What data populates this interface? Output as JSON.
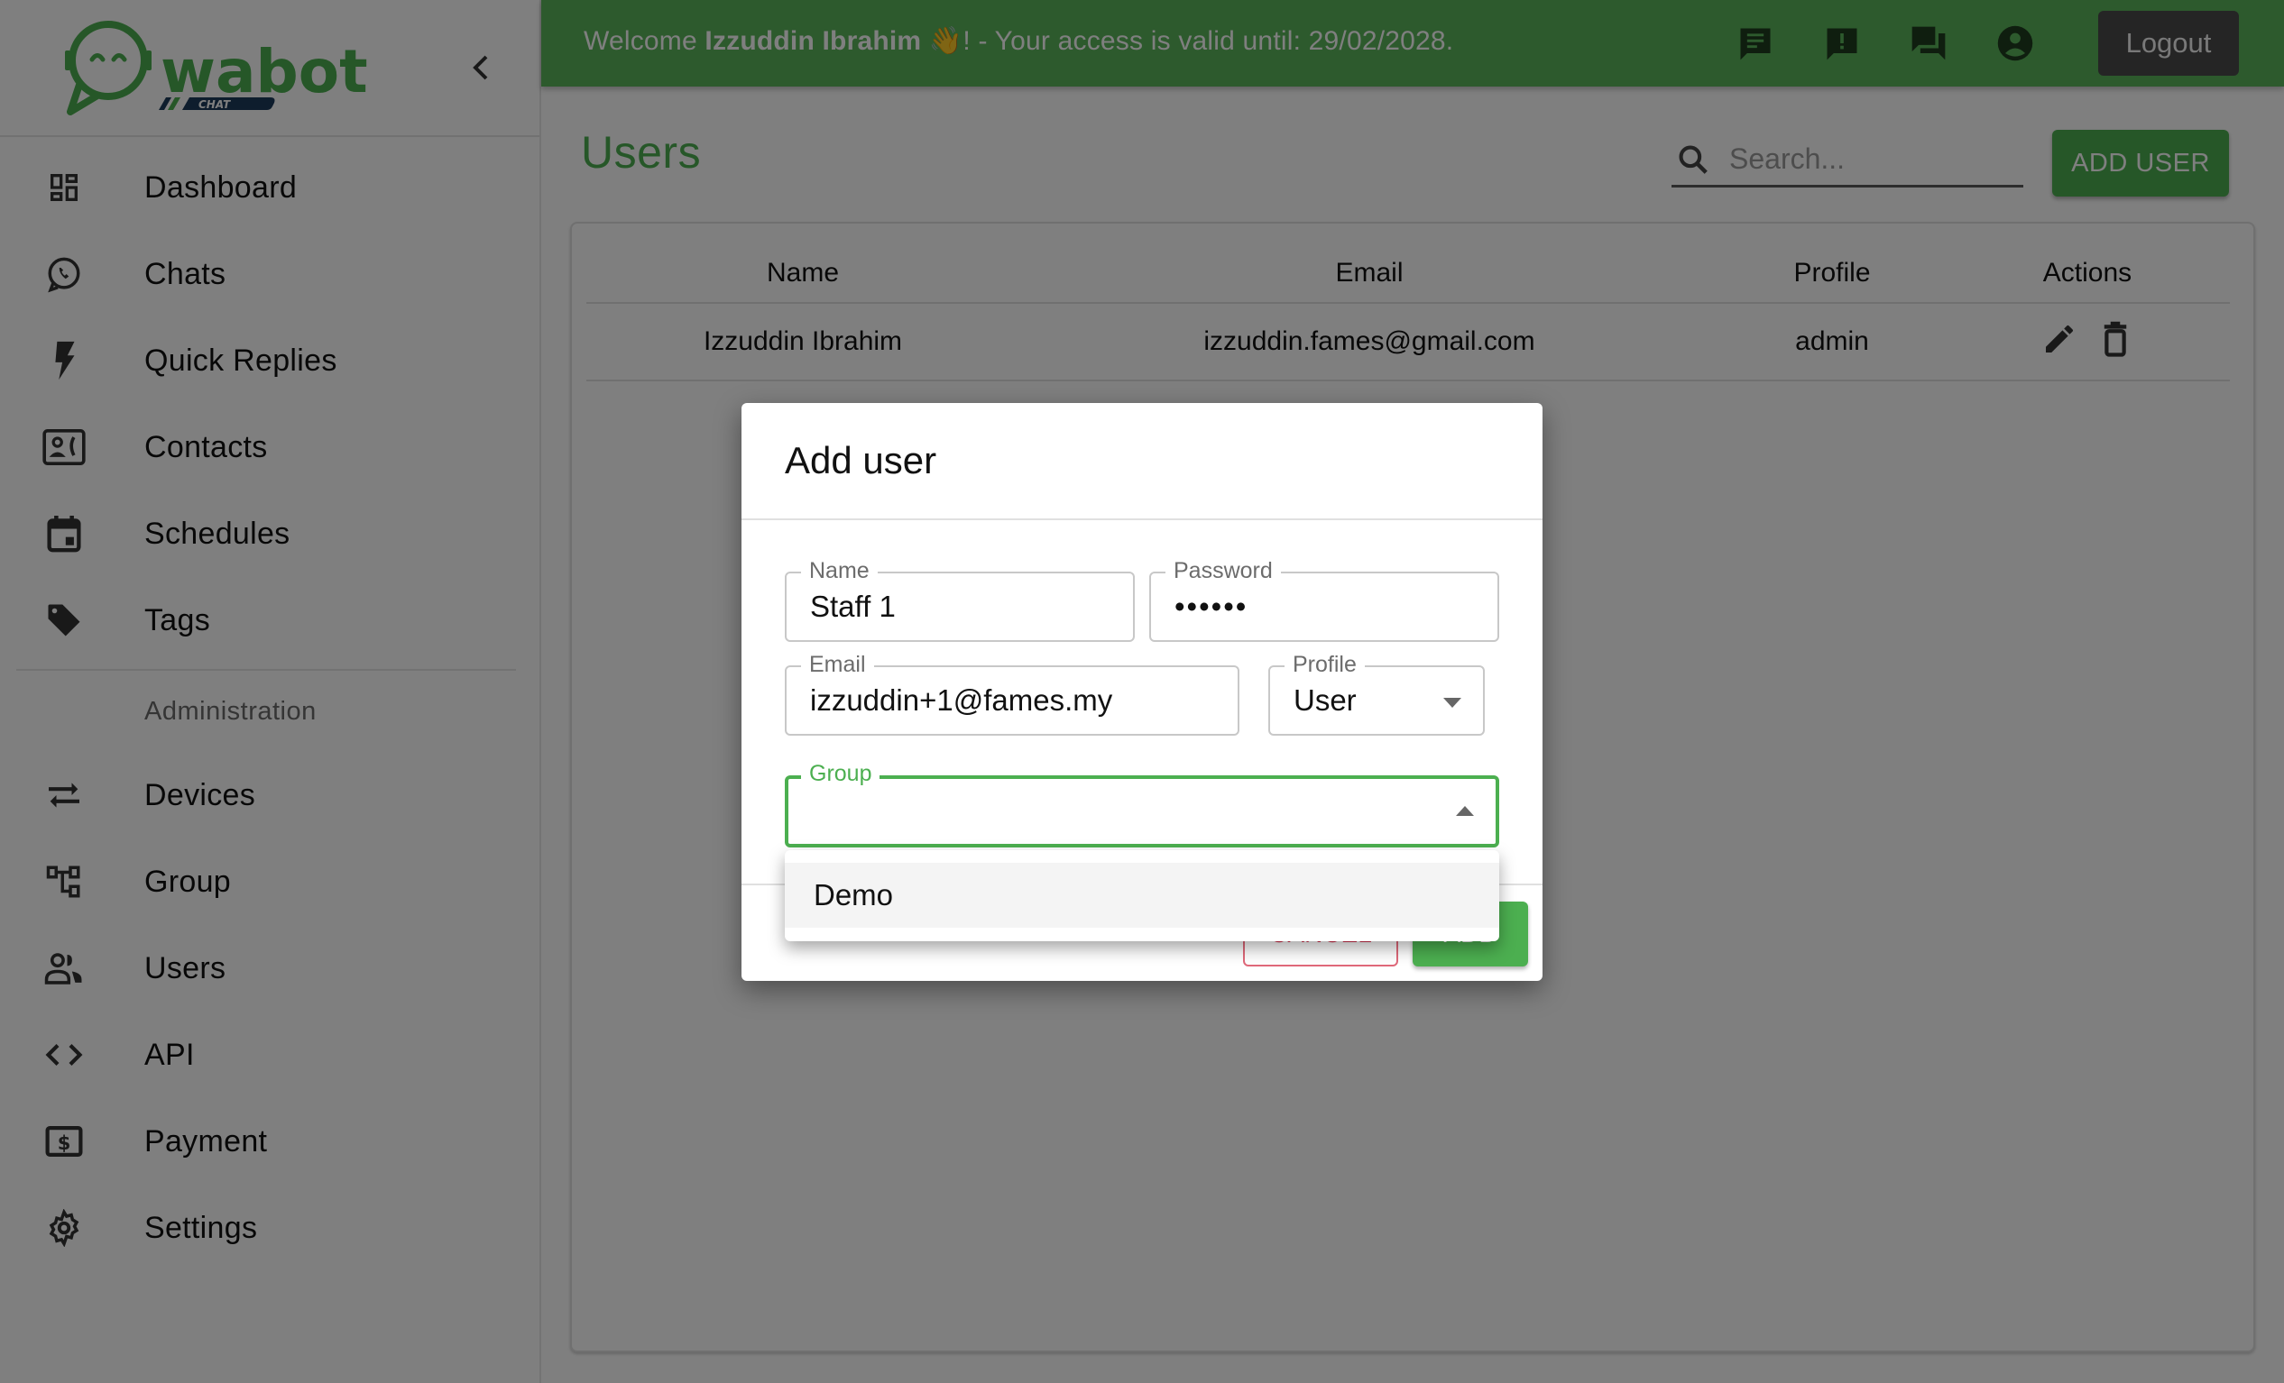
{
  "brand": {
    "logo_text": "wabot",
    "logo_badge": "CHAT",
    "colors": {
      "primary": "#4caf50",
      "topbar": "#5bb55b",
      "danger": "#d32f4b",
      "logout_bg": "#4a4a4a"
    }
  },
  "sidebar": {
    "collapse_icon": "chevron-left-icon",
    "items": [
      {
        "label": "Dashboard",
        "icon": "dashboard-icon"
      },
      {
        "label": "Chats",
        "icon": "whatsapp-icon"
      },
      {
        "label": "Quick Replies",
        "icon": "flash-icon"
      },
      {
        "label": "Contacts",
        "icon": "contact-phone-icon"
      },
      {
        "label": "Schedules",
        "icon": "calendar-icon"
      },
      {
        "label": "Tags",
        "icon": "tag-icon"
      }
    ],
    "admin_header": "Administration",
    "admin_items": [
      {
        "label": "Devices",
        "icon": "sync-alt-icon"
      },
      {
        "label": "Group",
        "icon": "account-tree-icon"
      },
      {
        "label": "Users",
        "icon": "people-icon"
      },
      {
        "label": "API",
        "icon": "code-icon"
      },
      {
        "label": "Payment",
        "icon": "payment-icon"
      },
      {
        "label": "Settings",
        "icon": "gear-icon"
      }
    ]
  },
  "topbar": {
    "welcome_prefix": "Welcome ",
    "user_name": "Izzuddin Ibrahim",
    "wave_emoji": "👋",
    "welcome_suffix": "! - Your access is valid until: 29/02/2028.",
    "icons": [
      "message-icon",
      "feedback-icon",
      "forum-icon",
      "account-circle-icon"
    ],
    "logout_label": "Logout"
  },
  "main": {
    "title": "Users",
    "search": {
      "placeholder": "Search...",
      "value": ""
    },
    "add_button": "ADD USER",
    "table": {
      "columns": [
        "Name",
        "Email",
        "Profile",
        "Actions"
      ],
      "rows": [
        {
          "name": "Izzuddin Ibrahim",
          "email": "izzuddin.fames@gmail.com",
          "profile": "admin",
          "actions": [
            "edit-icon",
            "delete-icon"
          ]
        }
      ]
    }
  },
  "dialog": {
    "title": "Add user",
    "fields": {
      "name": {
        "label": "Name",
        "value": "Staff 1"
      },
      "password": {
        "label": "Password",
        "value": "••••••"
      },
      "email": {
        "label": "Email",
        "value": "izzuddin+1@fames.my"
      },
      "profile": {
        "label": "Profile",
        "value": "User"
      },
      "group": {
        "label": "Group",
        "value": ""
      }
    },
    "cancel_label": "CANCEL",
    "save_label": "ADD",
    "group_options": [
      "Demo"
    ]
  }
}
